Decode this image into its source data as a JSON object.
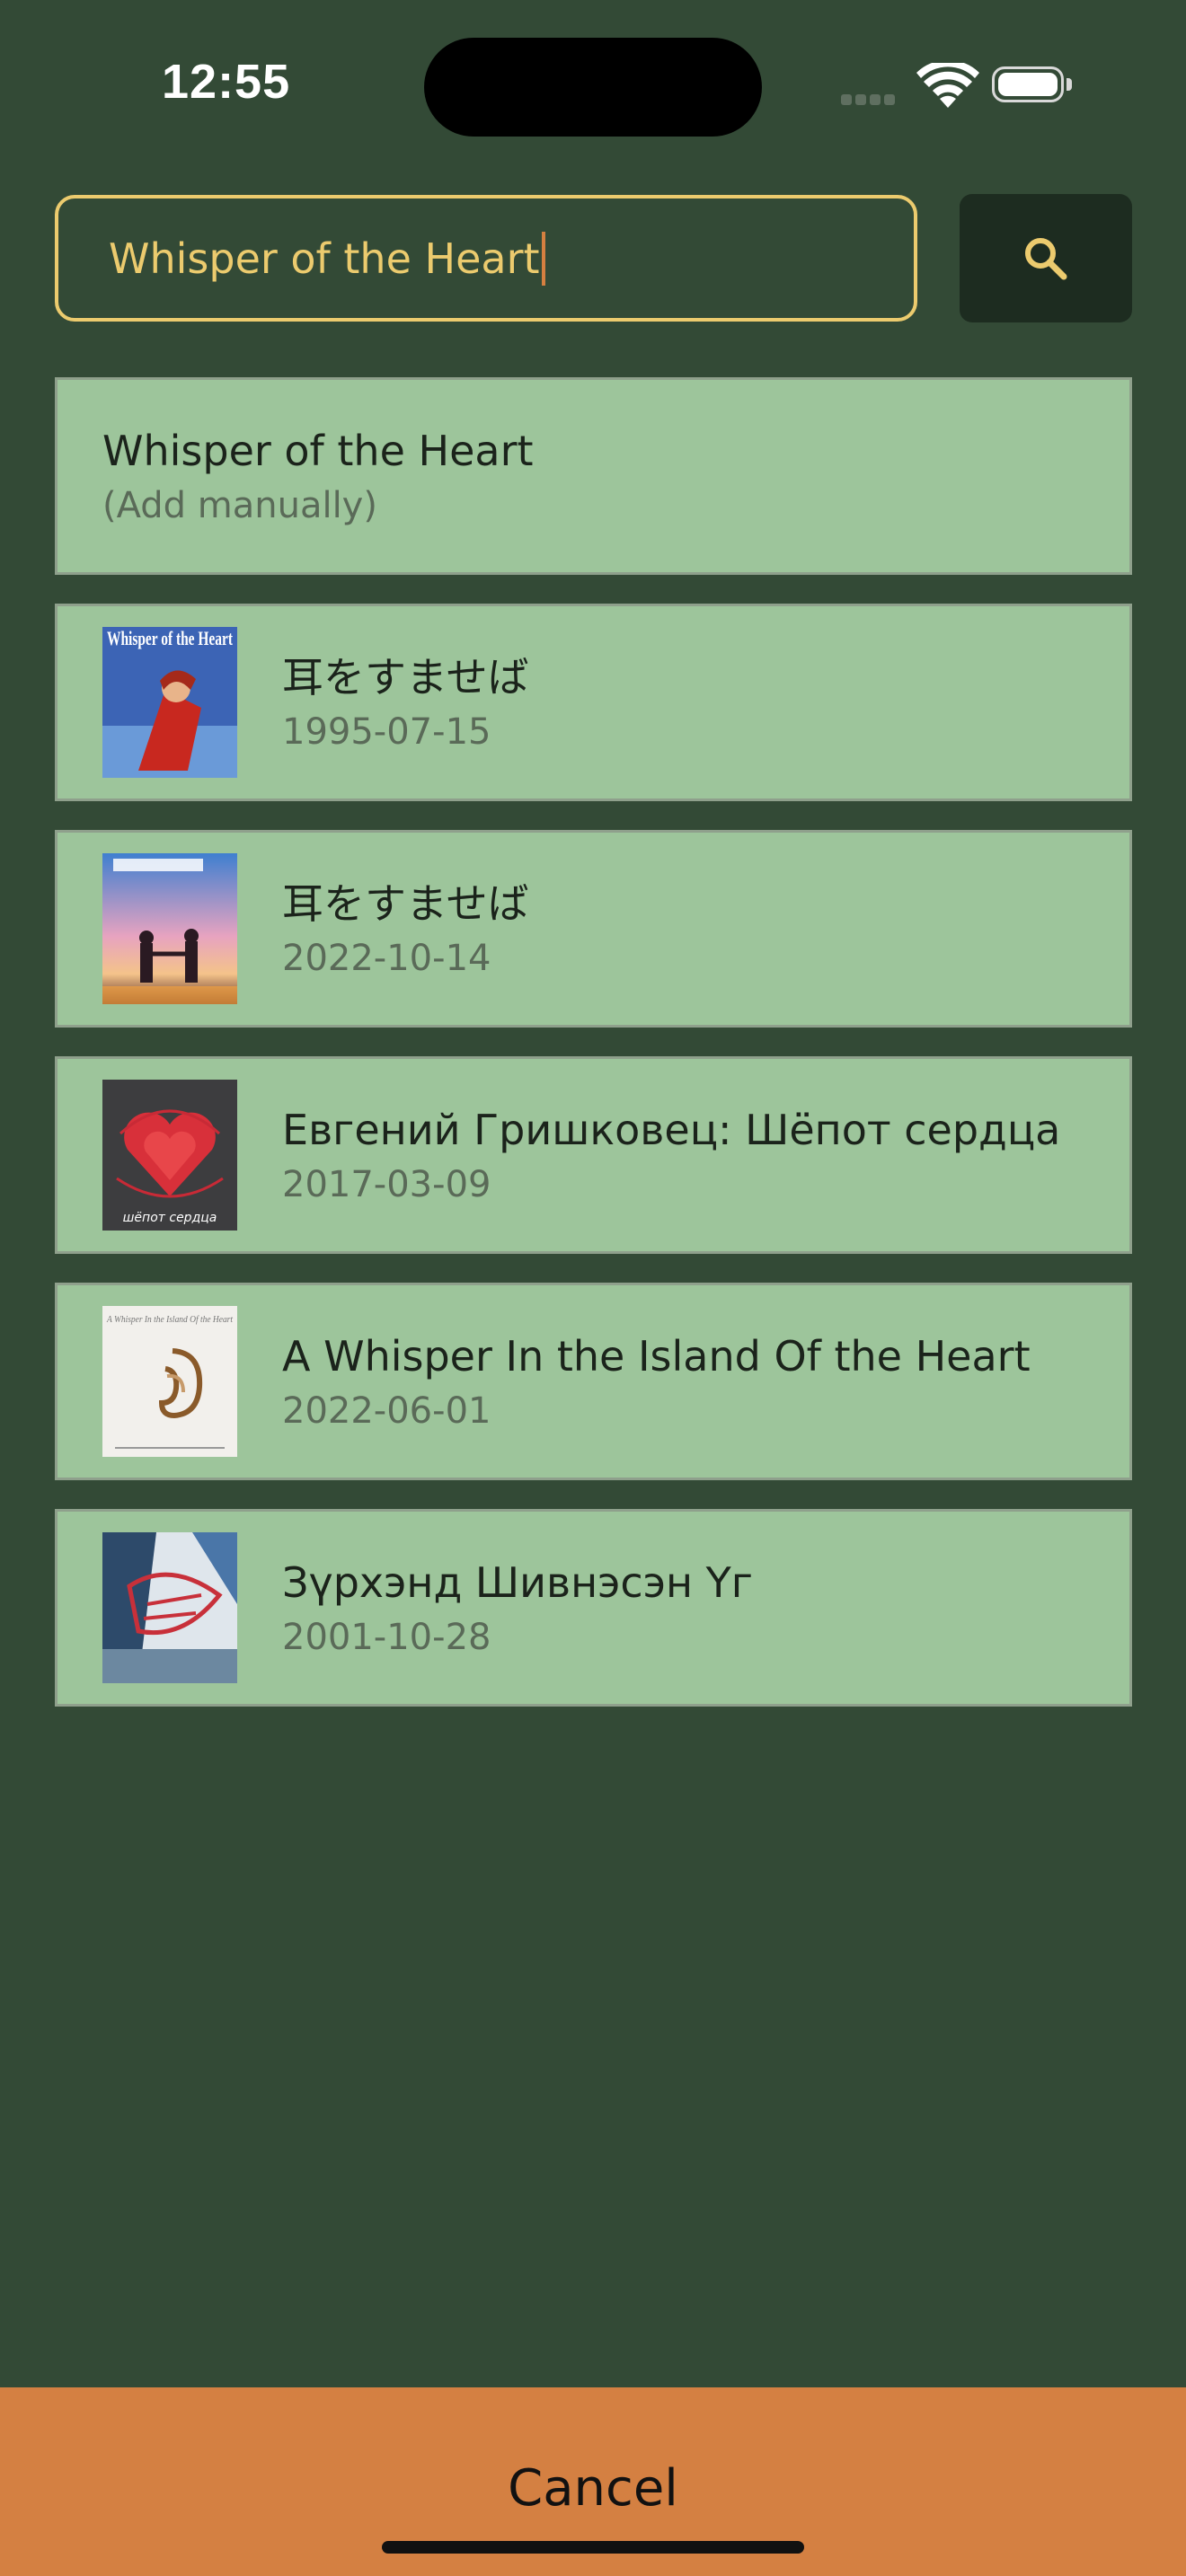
{
  "status_bar": {
    "time": "12:55"
  },
  "search": {
    "value": "Whisper of the Heart"
  },
  "manual_entry": {
    "title": "Whisper of the Heart",
    "subtitle": "(Add manually)"
  },
  "results": [
    {
      "title": "耳をすませば",
      "date": "1995-07-15",
      "poster_text": "Whisper of the Heart"
    },
    {
      "title": "耳をすませば",
      "date": "2022-10-14"
    },
    {
      "title": "Евгений Гришковец: Шёпот сердца",
      "date": "2017-03-09",
      "poster_text": "шёпот сердца"
    },
    {
      "title": "A Whisper In the Island Of the Heart",
      "date": "2022-06-01",
      "poster_text": "A Whisper In the Island Of the Heart"
    },
    {
      "title": "Зүрхэнд Шивнэсэн Үг",
      "date": "2001-10-28"
    }
  ],
  "footer": {
    "cancel_label": "Cancel"
  },
  "colors": {
    "background": "#334a36",
    "accent": "#eccb6e",
    "card": "#9dc59b",
    "cancel_bar": "#d48042"
  },
  "icons": [
    "search-icon",
    "wifi-icon",
    "battery-icon",
    "cellular-icon"
  ]
}
